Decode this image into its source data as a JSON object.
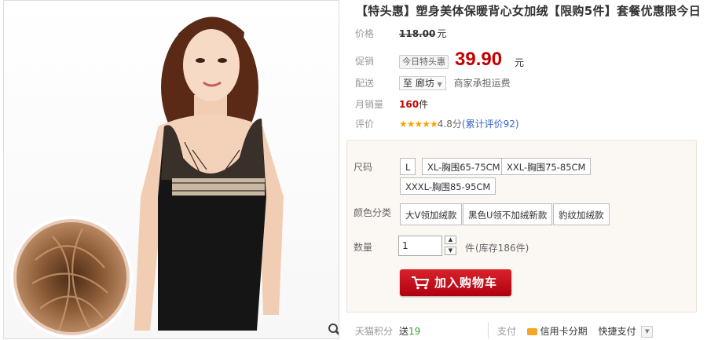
{
  "product": {
    "title": "【特头惠】塑身美体保暖背心女加绒【限购5件】套餐优惠限今日"
  },
  "price": {
    "label": "价格",
    "original": "118.00",
    "unit": "元"
  },
  "promo": {
    "label": "促销",
    "tag": "今日特头惠",
    "price": "39.90",
    "unit": "元"
  },
  "shipping": {
    "label": "配送",
    "destination": "至 廊坊",
    "note": "商家承担运费"
  },
  "sales": {
    "label": "月销量",
    "count": "160",
    "unit": "件"
  },
  "rating": {
    "label": "评价",
    "stars": "★★★★★",
    "score": "4.8分",
    "reviews": "(累计评价92)",
    "star_color": "#f6a700"
  },
  "sku": {
    "size_label": "尺码",
    "sizes": [
      "L",
      "XL-胸围65-75CM",
      "XXL-胸围75-85CM",
      "XXXL-胸围85-95CM"
    ],
    "color_label": "颜色分类",
    "colors": [
      "大V领加绒款",
      "黑色U领不加绒新款",
      "豹纹加绒款"
    ],
    "qty_label": "数量",
    "qty_value": "1",
    "stock_unit": "件",
    "stock_note": "(库存186件)"
  },
  "cart": {
    "button_label": "加入购物车",
    "color": "#c8101e"
  },
  "footer": {
    "points_label": "天猫积分",
    "points_prefix": "送",
    "points_value": "19",
    "pay_label": "支付",
    "credit_label": "信用卡分期",
    "quick_label": "快捷支付"
  },
  "accent": "#c40000"
}
